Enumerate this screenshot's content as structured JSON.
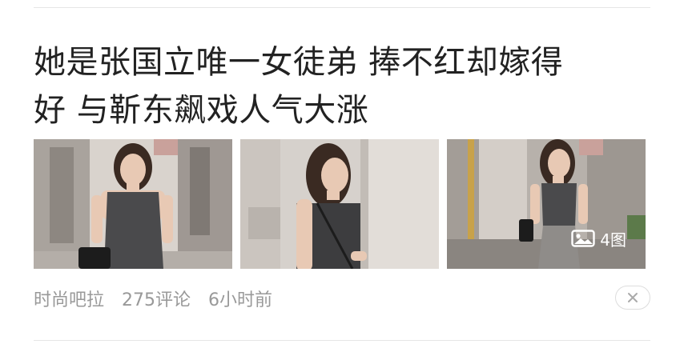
{
  "article": {
    "title_line1": "她是张国立唯一女徒弟 捧不红却嫁得",
    "title_line2": "好 与靳东飙戏人气大涨",
    "image_count_label": "4图",
    "image_count_icon": "gallery-icon",
    "source": "时尚吧拉",
    "comments": "275评论",
    "time": "6小时前",
    "dismiss_icon": "close-icon"
  },
  "colors": {
    "title": "#222222",
    "meta": "#999999",
    "divider": "#e6e6e6",
    "dress": "#4a4a4c"
  }
}
